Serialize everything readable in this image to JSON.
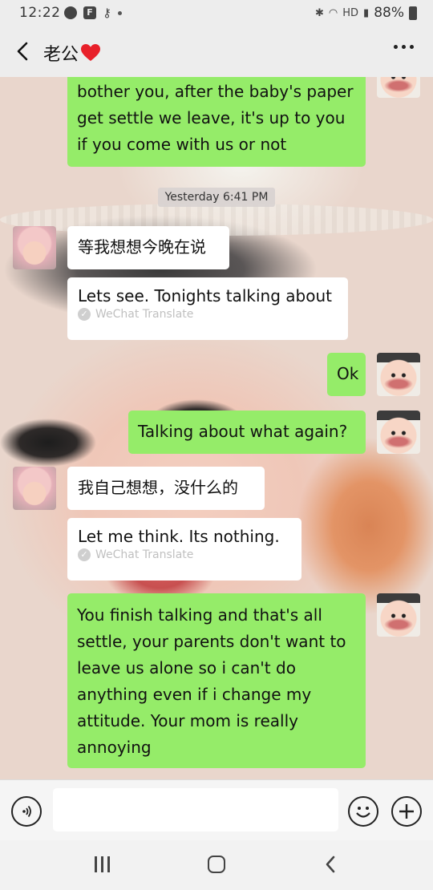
{
  "status_bar": {
    "time": "12:22",
    "battery": "88%",
    "hd_label": "HD"
  },
  "header": {
    "title": "老公",
    "icons": {
      "back": "chevron-left-icon",
      "heart": "heart-icon",
      "more": "more-dots-icon"
    }
  },
  "chat": {
    "timestamp": "Yesterday 6:41 PM",
    "translate_label": "WeChat Translate",
    "messages": [
      {
        "side": "right",
        "lines": [
          "bother you, after the baby's paper",
          "get settle we leave, it's up to you",
          "if you come with us or not"
        ]
      },
      {
        "side": "left",
        "text": "等我想想今晚在说",
        "translation": "Lets see. Tonights talking about"
      },
      {
        "side": "right",
        "text": "Ok"
      },
      {
        "side": "right",
        "text": "Talking about what again?"
      },
      {
        "side": "left",
        "text": "我自己想想，没什么的",
        "translation": "Let me think. Its nothing."
      },
      {
        "side": "right",
        "lines": [
          "You finish talking and that's all",
          "settle, your parents don't want to",
          "leave us alone so i can't do",
          "anything even if i change my",
          "attitude. Your mom is really",
          "annoying"
        ]
      }
    ]
  },
  "input_bar": {
    "placeholder": "",
    "icons": {
      "voice": "voice-icon",
      "emoji": "emoji-icon",
      "plus": "plus-icon"
    }
  },
  "colors": {
    "sent_bubble": "#95ec69",
    "received_bubble": "#ffffff",
    "header_bg": "#ededed"
  }
}
